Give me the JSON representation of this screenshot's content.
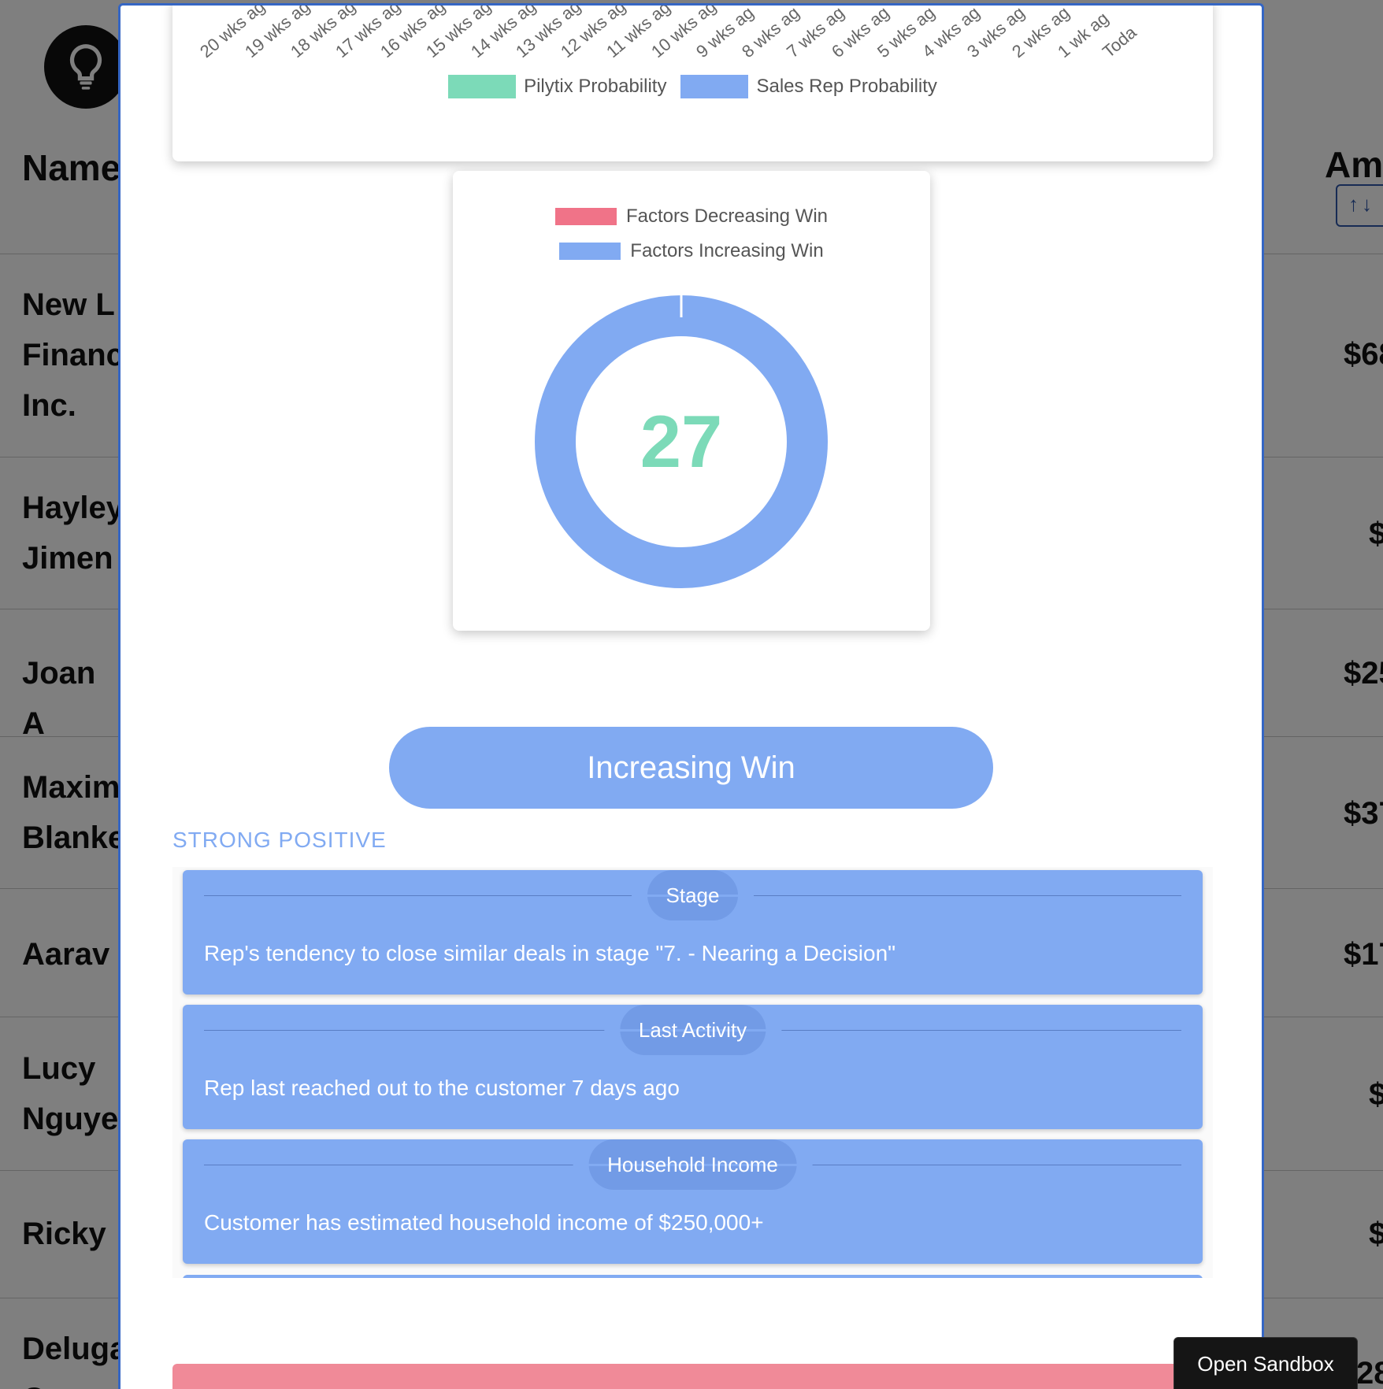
{
  "table": {
    "name_header": "Name",
    "amount_header": "Am",
    "sort_icons": "↑↓",
    "rows": [
      {
        "name": "New L\nFinanc\nInc.",
        "amount": "$68"
      },
      {
        "name": "Hayley\nJimen",
        "amount": "$"
      },
      {
        "name": "Joan A",
        "amount": "$25"
      },
      {
        "name": "Maxim\nBlanke",
        "amount": "$37"
      },
      {
        "name": "Aarav",
        "amount": "$17"
      },
      {
        "name": "Lucy\nNguye",
        "amount": "$"
      },
      {
        "name": "Ricky",
        "amount": "$"
      },
      {
        "name": "Deluga\nC",
        "amount": "28"
      }
    ]
  },
  "line_chart": {
    "x_ticks": [
      "20 wks ag",
      "19 wks ag",
      "18 wks ag",
      "17 wks ag",
      "16 wks ag",
      "15 wks ag",
      "14 wks ag",
      "13 wks ag",
      "12 wks ag",
      "11 wks ag",
      "10 wks ag",
      "9 wks ag",
      "8 wks ag",
      "7 wks ag",
      "6 wks ag",
      "5 wks ag",
      "4 wks ag",
      "3 wks ag",
      "2 wks ag",
      "1 wk ag",
      "Toda"
    ],
    "legend": [
      {
        "label": "Pilytix Probability",
        "color": "#7cdab8"
      },
      {
        "label": "Sales Rep Probability",
        "color": "#81aaf2"
      }
    ]
  },
  "chart_data": {
    "type": "pie",
    "title": "",
    "center_value": "27",
    "center_color": "#7cdab8",
    "legend": [
      {
        "label": "Factors Decreasing Win",
        "color": "#f07388"
      },
      {
        "label": "Factors Increasing Win",
        "color": "#81aaf2"
      }
    ],
    "categories": [
      "Factors Decreasing Win",
      "Factors Increasing Win"
    ],
    "values": [
      0,
      100
    ]
  },
  "increasing_win_label": "Increasing Win",
  "strength_label": "STRONG POSITIVE",
  "strength_color": "#81aaf2",
  "factors": [
    {
      "name": "Stage",
      "description": "Rep's tendency to close similar deals in stage \"7. - Nearing a Decision\""
    },
    {
      "name": "Last Activity",
      "description": "Rep last reached out to the customer 7 days ago"
    },
    {
      "name": "Household Income",
      "description": "Customer has estimated household income of $250,000+"
    }
  ],
  "sandbox_button": "Open Sandbox"
}
